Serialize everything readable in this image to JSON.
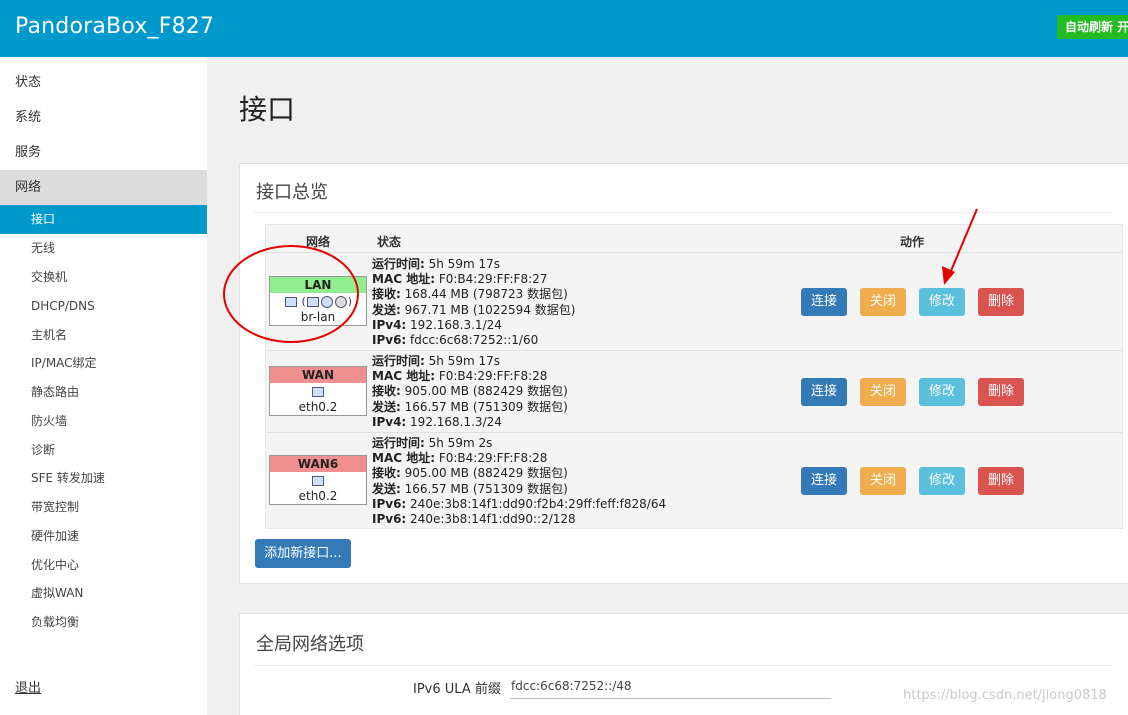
{
  "brand": "PandoraBox_F827",
  "refresh_badge": "自动刷新 开",
  "sidebar": {
    "top_items": [
      "状态",
      "系统",
      "服务",
      "网络"
    ],
    "sub_items": [
      "接口",
      "无线",
      "交换机",
      "DHCP/DNS",
      "主机名",
      "IP/MAC绑定",
      "静态路由",
      "防火墙",
      "诊断",
      "SFE 转发加速",
      "带宽控制",
      "硬件加速",
      "优化中心",
      "虚拟WAN",
      "负载均衡"
    ],
    "logout": "退出"
  },
  "page_title": "接口",
  "overview": {
    "title": "接口总览",
    "headers": {
      "network": "网络",
      "status": "状态",
      "actions": "动作"
    },
    "buttons": {
      "connect": "连接",
      "close": "关闭",
      "edit": "修改",
      "delete": "删除"
    },
    "interfaces": [
      {
        "name": "LAN",
        "device": "br-lan",
        "icons_text": "(  )",
        "color": "#90ee90",
        "lines": [
          [
            "运行时间:",
            " 5h 59m 17s"
          ],
          [
            "MAC 地址:",
            " F0:B4:29:FF:F8:27"
          ],
          [
            "接收:",
            " 168.44 MB (798723 数据包)"
          ],
          [
            "发送:",
            " 967.71 MB (1022594 数据包)"
          ],
          [
            "IPv4:",
            " 192.168.3.1/24"
          ],
          [
            "IPv6:",
            " fdcc:6c68:7252::1/60"
          ]
        ]
      },
      {
        "name": "WAN",
        "device": "eth0.2",
        "icons_text": "",
        "color": "#f08f8f",
        "lines": [
          [
            "运行时间:",
            " 5h 59m 17s"
          ],
          [
            "MAC 地址:",
            " F0:B4:29:FF:F8:28"
          ],
          [
            "接收:",
            " 905.00 MB (882429 数据包)"
          ],
          [
            "发送:",
            " 166.57 MB (751309 数据包)"
          ],
          [
            "IPv4:",
            " 192.168.1.3/24"
          ]
        ]
      },
      {
        "name": "WAN6",
        "device": "eth0.2",
        "icons_text": "",
        "color": "#f08f8f",
        "lines": [
          [
            "运行时间:",
            " 5h 59m 2s"
          ],
          [
            "MAC 地址:",
            " F0:B4:29:FF:F8:28"
          ],
          [
            "接收:",
            " 905.00 MB (882429 数据包)"
          ],
          [
            "发送:",
            " 166.57 MB (751309 数据包)"
          ],
          [
            "IPv6:",
            " 240e:3b8:14f1:dd90:f2b4:29ff:feff:f828/64"
          ],
          [
            "IPv6:",
            " 240e:3b8:14f1:dd90::2/128"
          ]
        ]
      }
    ],
    "add_button": "添加新接口..."
  },
  "global": {
    "title": "全局网络选项",
    "ula_label": "IPv6 ULA 前缀",
    "ula_value": "fdcc:6c68:7252::/48"
  },
  "watermark": "https://blog.csdn.net/jiong0818",
  "colors": {
    "topbar": "#0099cc",
    "annotation": "#e60000"
  }
}
